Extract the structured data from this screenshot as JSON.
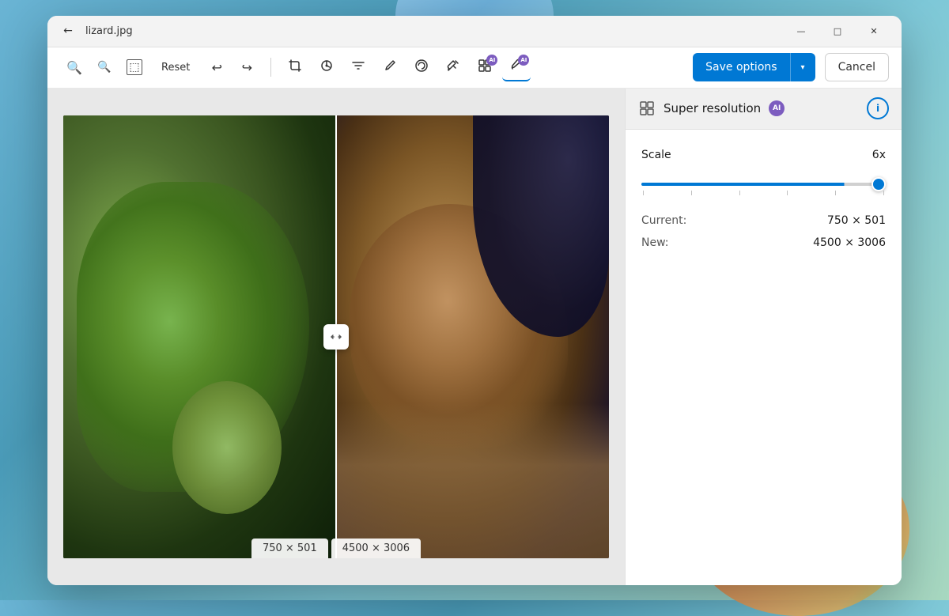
{
  "window": {
    "title": "lizard.jpg",
    "back_label": "←",
    "minimize_label": "—",
    "maximize_label": "□",
    "close_label": "✕"
  },
  "toolbar": {
    "reset_label": "Reset",
    "undo_icon": "↩",
    "redo_icon": "↪",
    "save_options_label": "Save options",
    "cancel_label": "Cancel",
    "crop_icon": "⬚",
    "brightness_icon": "☀",
    "filter_icon": "◐",
    "erase_icon": "/",
    "background_icon": "⊙",
    "ai_icon": "⚡",
    "ai_icon2": "⚡"
  },
  "panel": {
    "title": "Super resolution",
    "ai_badge": "AI",
    "info_icon": "i",
    "scale_label": "Scale",
    "scale_value": "6x",
    "slider_percent": 83,
    "current_label": "Current:",
    "current_value": "750 × 501",
    "new_label": "New:",
    "new_value": "4500 × 3006"
  },
  "image": {
    "left_size_label": "750 × 501",
    "right_size_label": "4500 × 3006"
  },
  "colors": {
    "accent": "#0078d4",
    "ai_purple": "#7c5cbf",
    "toolbar_bg": "#ffffff",
    "panel_bg": "#f0f0f0"
  }
}
